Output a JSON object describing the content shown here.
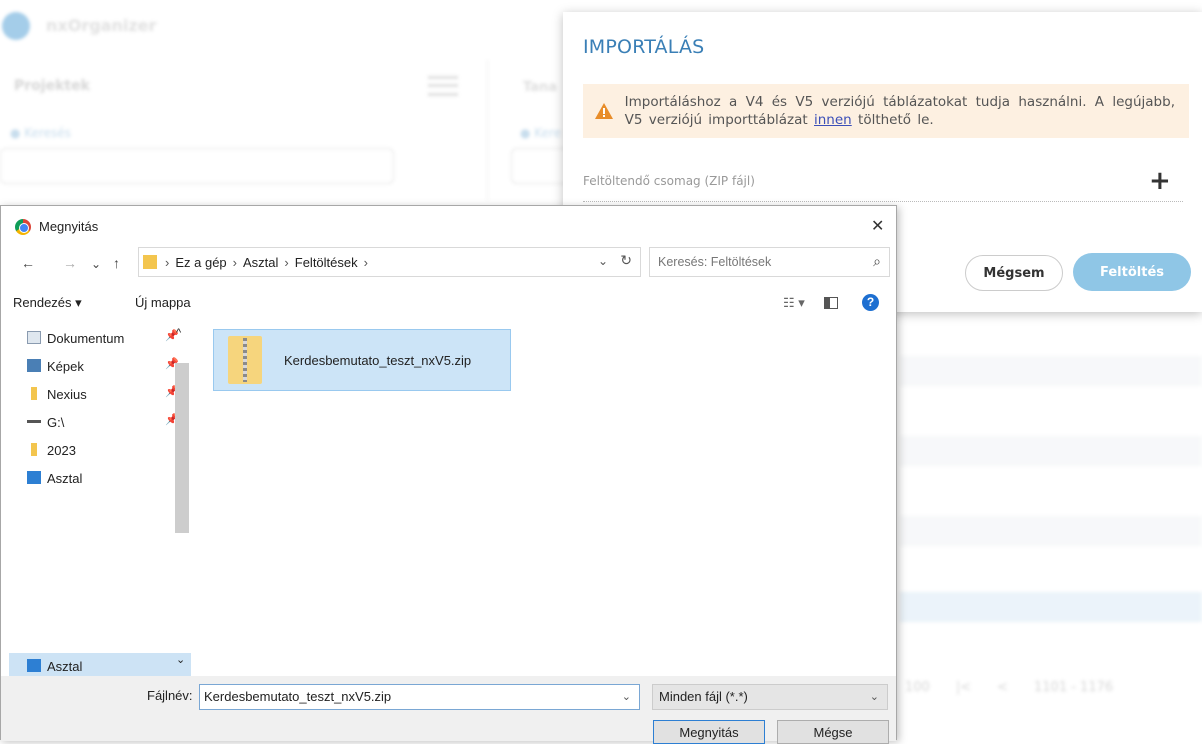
{
  "background_app": {
    "brand": "nxOrganizer",
    "projects_title": "Projektek",
    "search_label": "Keresés",
    "search_placeholder": "",
    "second_panel_title": "Tana",
    "second_search_label": "Kere",
    "pager": [
      "100",
      "|<",
      "<",
      "1101 - 1176"
    ]
  },
  "import_modal": {
    "title": "IMPORTÁLÁS",
    "alert_text_before": "Importáláshoz a V4 és V5 verziójú táblázatokat tudja használni. A legújabb, V5 verziójú importtáblázat ",
    "alert_link": "innen",
    "alert_text_after": " tölthető le.",
    "package_label": "Feltöltendő csomag (ZIP fájl)",
    "add_icon": "plus-icon",
    "cancel_label": "Mégsem",
    "upload_label": "Feltöltés",
    "colors": {
      "title": "#3a7fb6",
      "alert_bg": "#fdf0e1",
      "warn": "#e88d2a",
      "upload_bg": "#8fc6e6"
    }
  },
  "open_dialog": {
    "title": "Megnyitás",
    "close": "✕",
    "nav": {
      "back": "←",
      "forward": "→",
      "recent": "⌄",
      "up": "↑"
    },
    "breadcrumb": [
      "Ez a gép",
      "Asztal",
      "Feltöltések"
    ],
    "search_placeholder": "Keresés: Feltöltések",
    "toolbar": {
      "organize": "Rendezés ▾",
      "new_folder": "Új mappa"
    },
    "sidebar": [
      {
        "label": "Dokumentum",
        "icon": "document-icon",
        "pinned": true
      },
      {
        "label": "Képek",
        "icon": "pictures-icon",
        "pinned": true
      },
      {
        "label": "Nexius",
        "icon": "folder-icon",
        "pinned": true
      },
      {
        "label": "G:\\",
        "icon": "network-drive-icon",
        "pinned": true
      },
      {
        "label": "2023",
        "icon": "folder-icon",
        "pinned": false
      },
      {
        "label": "Asztal",
        "icon": "desktop-icon",
        "pinned": false
      }
    ],
    "sidebar_selected": "Asztal",
    "files": [
      {
        "name": "Kerdesbemutato_teszt_nxV5.zip",
        "icon": "zip-folder-icon",
        "selected": true
      }
    ],
    "filename_label": "Fájlnév:",
    "filename_value": "Kerdesbemutato_teszt_nxV5.zip",
    "filetype_value": "Minden fájl (*.*)",
    "open_button": "Megnyitás",
    "cancel_button": "Mégse"
  }
}
